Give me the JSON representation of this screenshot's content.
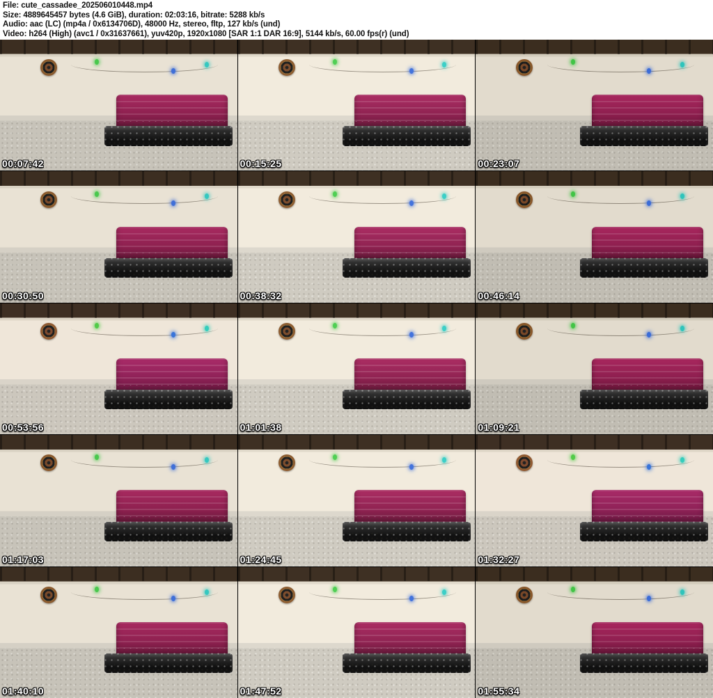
{
  "header": {
    "lines": [
      "File: cute_cassadee_202506010448.mp4",
      "Size: 4889645457 bytes (4.6 GiB), duration: 02:03:16, bitrate: 5288 kb/s",
      "Audio: aac (LC) (mp4a / 0x6134706D), 48000 Hz, stereo, fltp, 127 kb/s (und)",
      "Video: h264 (High) (avc1 / 0x31637661), yuv420p, 1920x1080 [SAR 1:1 DAR 16:9], 5144 kb/s, 60.00 fps(r) (und)"
    ]
  },
  "grid": {
    "rows": 5,
    "columns": 3,
    "thumbnails": [
      {
        "timestamp": "00:07:42"
      },
      {
        "timestamp": "00:15:25"
      },
      {
        "timestamp": "00:23:07"
      },
      {
        "timestamp": "00:30:50"
      },
      {
        "timestamp": "00:38:32"
      },
      {
        "timestamp": "00:46:14"
      },
      {
        "timestamp": "00:53:56"
      },
      {
        "timestamp": "01:01:38"
      },
      {
        "timestamp": "01:09:21"
      },
      {
        "timestamp": "01:17:03"
      },
      {
        "timestamp": "01:24:45"
      },
      {
        "timestamp": "01:32:27"
      },
      {
        "timestamp": "01:40:10"
      },
      {
        "timestamp": "01:47:52"
      },
      {
        "timestamp": "01:55:34"
      }
    ]
  },
  "colors": {
    "header_bg": "#ffffff",
    "header_text": "#111111",
    "grid_bg": "#000000",
    "timestamp_text": "#ffffff",
    "wall": "#e9e2d4",
    "carpet": "#c7c3b9",
    "booth": "#8e2150",
    "ceiling": "#3c2e21",
    "light_teal": "#35c8c0",
    "light_blue": "#3f6fd8",
    "light_green": "#49c84d"
  }
}
